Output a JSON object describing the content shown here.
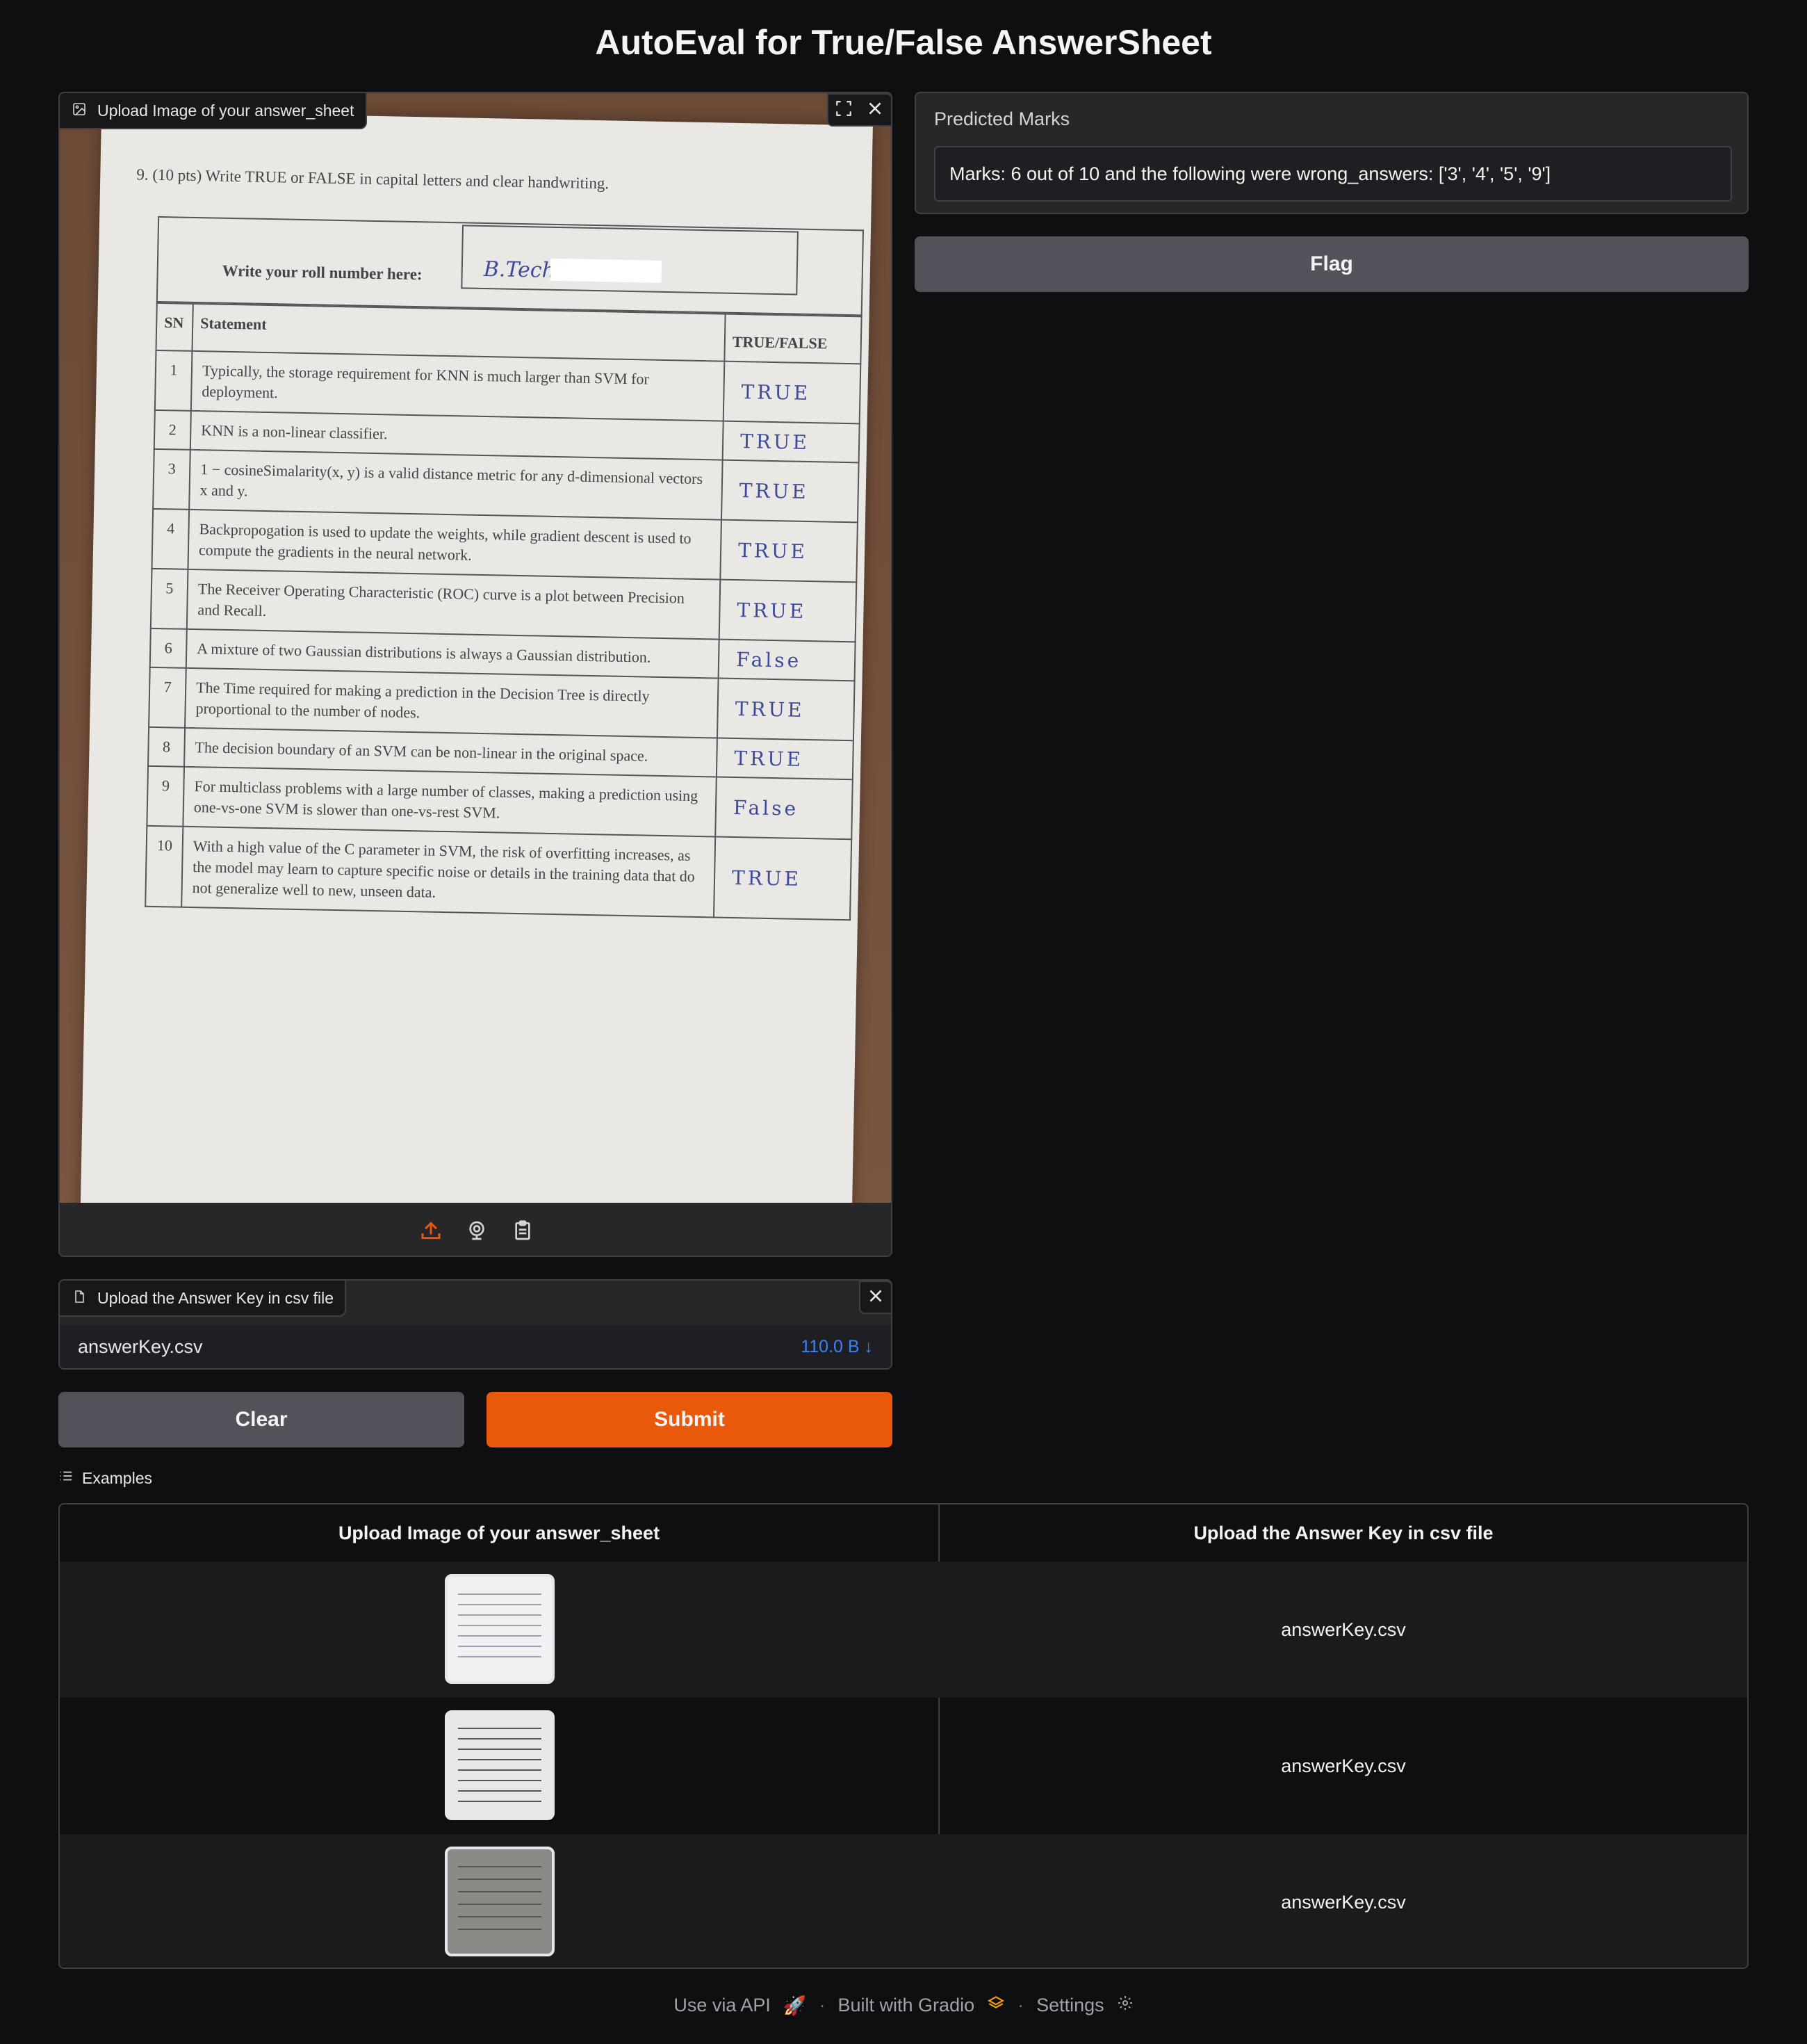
{
  "app": {
    "title": "AutoEval for True/False AnswerSheet"
  },
  "image_input": {
    "label": "Upload Image of your answer_sheet",
    "sheet": {
      "instruction": "9. (10 pts) Write TRUE or FALSE in capital letters and clear handwriting.",
      "roll_label": "Write your roll number here:",
      "roll_handwriting": "B.Tech",
      "headers": [
        "SN",
        "Statement",
        "TRUE/FALSE"
      ],
      "rows": [
        {
          "sn": "1",
          "statement": "Typically, the storage requirement for KNN is much larger than SVM for deployment.",
          "answer": "TRUE"
        },
        {
          "sn": "2",
          "statement": "KNN is a non-linear classifier.",
          "answer": "TRUE"
        },
        {
          "sn": "3",
          "statement": "1 − cosineSimalarity(x, y) is a valid distance metric for any d-dimensional vectors x and y.",
          "answer": "TRUE"
        },
        {
          "sn": "4",
          "statement": "Backpropogation is used to update the weights, while gradient descent is used to compute the gradients in the neural network.",
          "answer": "TRUE"
        },
        {
          "sn": "5",
          "statement": "The Receiver Operating Characteristic (ROC) curve is a plot between Precision and Recall.",
          "answer": "TRUE"
        },
        {
          "sn": "6",
          "statement": "A mixture of two Gaussian distributions is always a Gaussian distribution.",
          "answer": "False"
        },
        {
          "sn": "7",
          "statement": "The Time required for making a prediction in the Decision Tree is directly proportional to the number of nodes.",
          "answer": "TRUE"
        },
        {
          "sn": "8",
          "statement": "The decision boundary of an SVM can be non-linear in the original space.",
          "answer": "TRUE"
        },
        {
          "sn": "9",
          "statement": "For multiclass problems with a large number of classes, making a prediction using one-vs-one SVM is slower than one-vs-rest SVM.",
          "answer": "False"
        },
        {
          "sn": "10",
          "statement": "With a high value of the C parameter in SVM, the risk of overfitting increases, as the model may learn to capture specific noise or details in the training data that do not generalize well to new, unseen data.",
          "answer": "TRUE"
        }
      ]
    },
    "toolbar_icons": [
      "upload-icon",
      "webcam-icon",
      "clipboard-icon"
    ]
  },
  "csv_input": {
    "label": "Upload the Answer Key in csv file",
    "file_name": "answerKey.csv",
    "file_size": "110.0 B ↓"
  },
  "output": {
    "label": "Predicted Marks",
    "value": "Marks: 6 out of 10 and the following were wrong_answers: ['3', '4', '5', '9']"
  },
  "buttons": {
    "flag": "Flag",
    "clear": "Clear",
    "submit": "Submit"
  },
  "examples": {
    "title": "Examples",
    "headers": [
      "Upload Image of your answer_sheet",
      "Upload the Answer Key in csv file"
    ],
    "rows": [
      {
        "csv": "answerKey.csv"
      },
      {
        "csv": "answerKey.csv"
      },
      {
        "csv": "answerKey.csv"
      }
    ]
  },
  "footer": {
    "api": "Use via API",
    "built": "Built with Gradio",
    "settings": "Settings"
  },
  "colors": {
    "accent": "#ea580c",
    "background": "#0f0f11",
    "panel": "#27272a",
    "link": "#3b82f6"
  }
}
